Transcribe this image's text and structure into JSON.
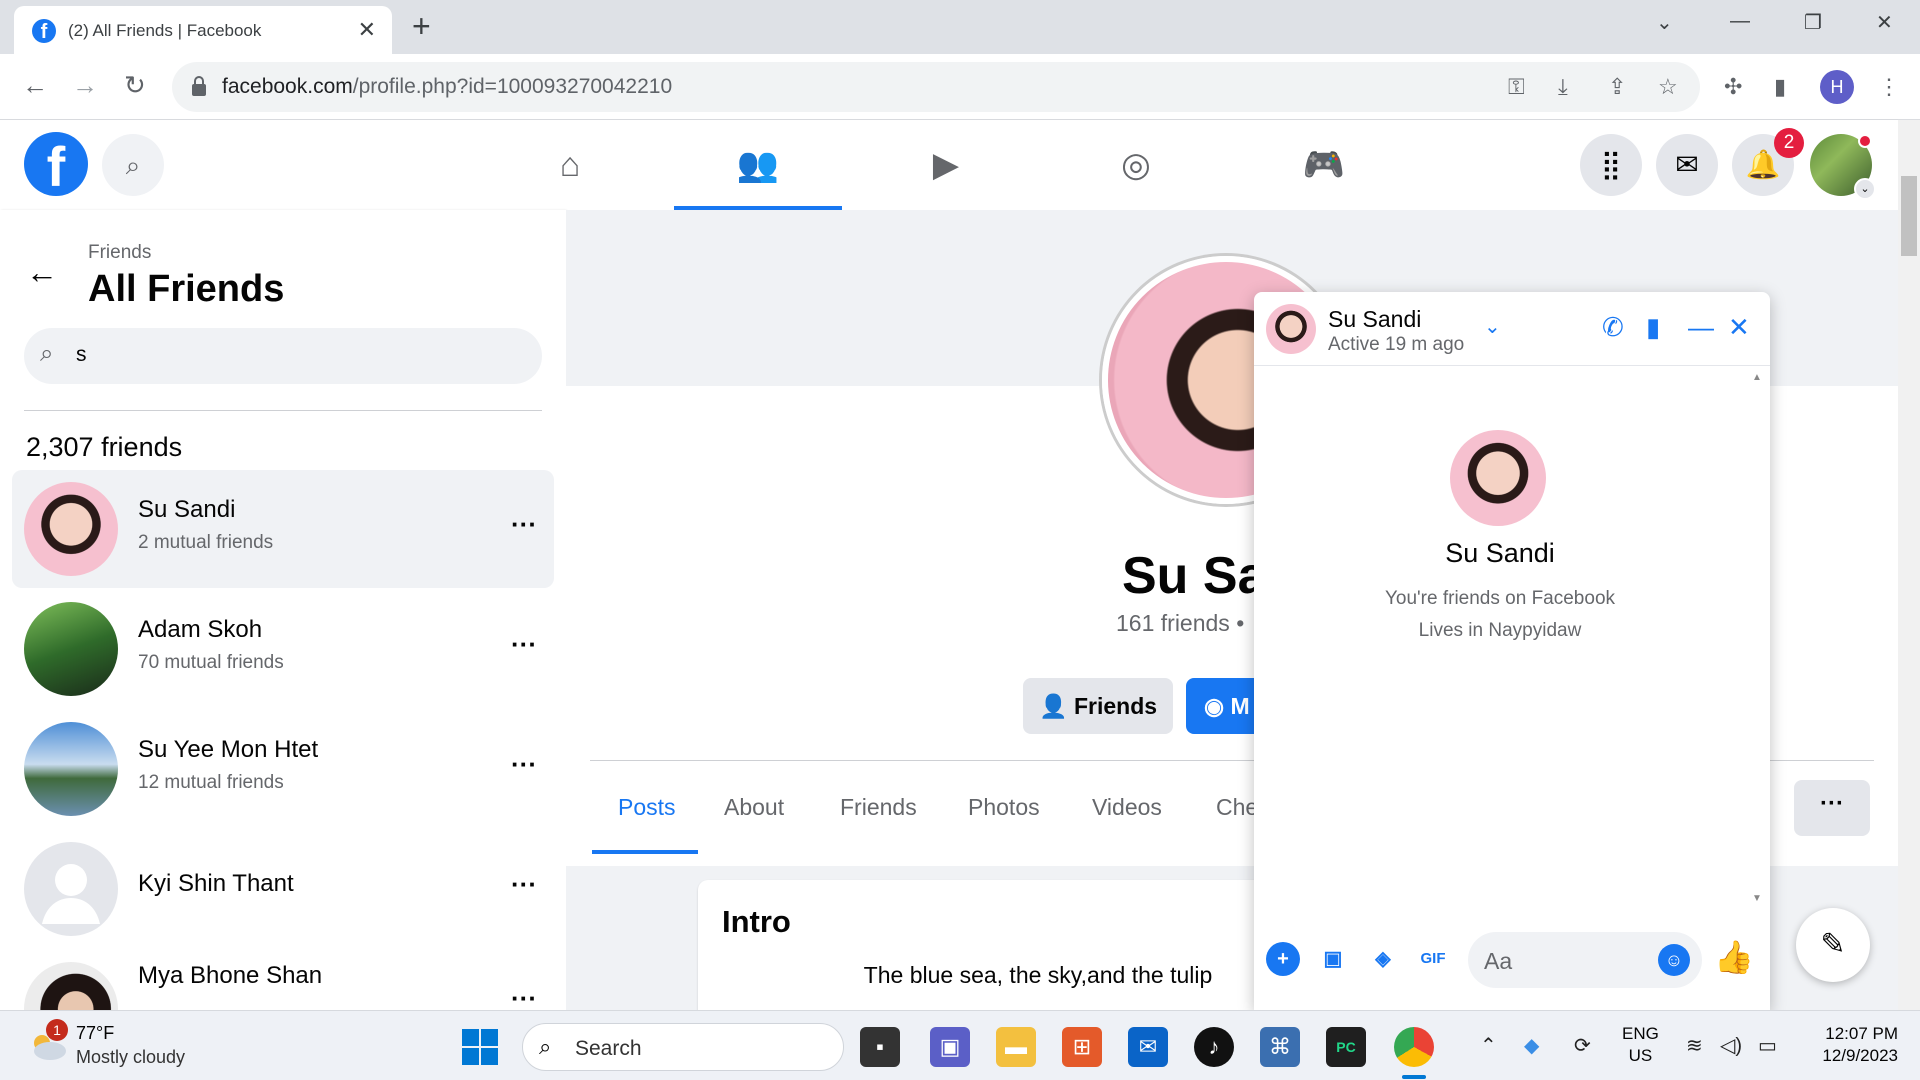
{
  "browser": {
    "tab_title": "(2) All Friends | Facebook",
    "url_host": "facebook.com",
    "url_path": "/profile.php?id=100093270042210",
    "profile_initial": "H"
  },
  "fb_nav": {
    "notifications_count": "2"
  },
  "sidebar": {
    "breadcrumb": "Friends",
    "title": "All Friends",
    "search_value": "s",
    "friend_count": "2,307 friends",
    "friends": [
      {
        "name": "Su Sandi",
        "mutual": "2 mutual friends"
      },
      {
        "name": "Adam Skoh",
        "mutual": "70 mutual friends"
      },
      {
        "name": "Su Yee Mon Htet",
        "mutual": "12 mutual friends"
      },
      {
        "name": "Kyi Shin Thant",
        "mutual": ""
      },
      {
        "name": "Mya Bhone Shan",
        "mutual": ""
      }
    ]
  },
  "profile": {
    "name": "Su Sa",
    "friends_line": "161 friends •",
    "friends_button": "Friends",
    "message_button": "M",
    "tabs": [
      "Posts",
      "About",
      "Friends",
      "Photos",
      "Videos",
      "Che"
    ],
    "intro_title": "Intro",
    "intro_bio": "The blue sea, the sky,and the tulip"
  },
  "chat": {
    "name": "Su Sandi",
    "status": "Active 19 m ago",
    "big_name": "Su Sandi",
    "info_line1": "You're friends on Facebook",
    "info_line2": "Lives in Naypyidaw",
    "input_placeholder": "Aa",
    "gif_label": "GIF"
  },
  "taskbar": {
    "weather_badge": "1",
    "temperature": "77°F",
    "weather": "Mostly cloudy",
    "search_label": "Search",
    "lang_line1": "ENG",
    "lang_line2": "US",
    "time": "12:07 PM",
    "date": "12/9/2023"
  }
}
